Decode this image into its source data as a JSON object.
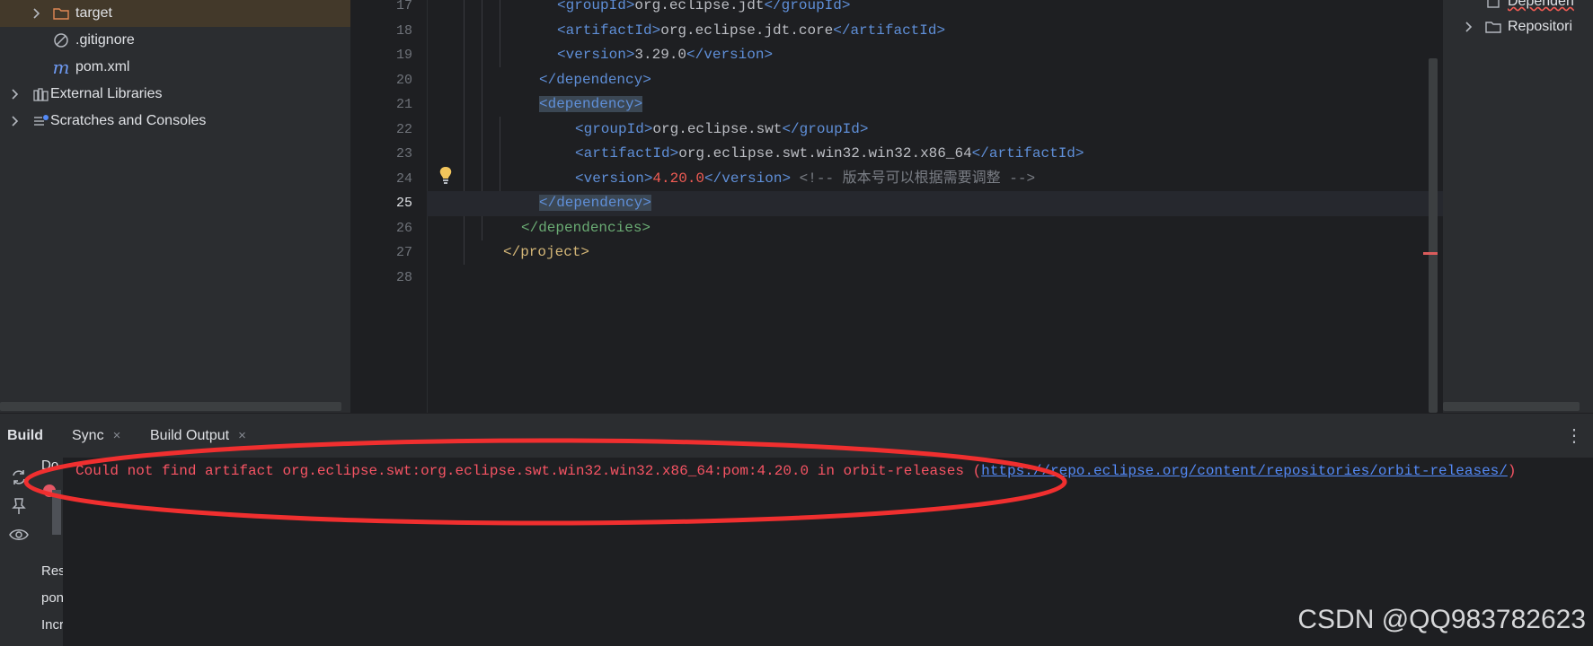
{
  "project_tree": {
    "items": [
      {
        "label": "target",
        "icon": "folder-icon",
        "expandable": true,
        "selected": true
      },
      {
        "label": ".gitignore",
        "icon": "ignored-file-icon",
        "expandable": false
      },
      {
        "label": "pom.xml",
        "icon": "maven-file-icon",
        "expandable": false
      },
      {
        "label": "External Libraries",
        "icon": "library-icon",
        "expandable": true
      },
      {
        "label": "Scratches and Consoles",
        "icon": "scratches-icon",
        "expandable": true
      }
    ]
  },
  "editor": {
    "current_line": 25,
    "line_numbers": [
      "17",
      "18",
      "19",
      "20",
      "21",
      "22",
      "23",
      "24",
      "25",
      "26",
      "27",
      "28"
    ],
    "lines": {
      "l17": {
        "open": "<groupId>",
        "text": "org.eclipse.jdt",
        "close": "</groupId>"
      },
      "l18": {
        "open": "<artifactId>",
        "text": "org.eclipse.jdt.core",
        "close": "</artifactId>"
      },
      "l19": {
        "open": "<version>",
        "text": "3.29.0",
        "close": "</version>"
      },
      "l20": {
        "close": "</dependency>"
      },
      "l21": {
        "open": "<dependency>"
      },
      "l22": {
        "open": "<groupId>",
        "text": "org.eclipse.swt",
        "close": "</groupId>"
      },
      "l23": {
        "open": "<artifactId>",
        "text": "org.eclipse.swt.win32.win32.x86_64",
        "close": "</artifactId>"
      },
      "l24": {
        "open": "<version>",
        "text": "4.20.0",
        "close": "</version>",
        "comment": "<!-- 版本号可以根据需要调整 -->"
      },
      "l25": {
        "close": "</dependency>"
      },
      "l26": {
        "close": "</dependencies>"
      },
      "l27": {
        "close": "</project>"
      }
    }
  },
  "maven_pane": {
    "items": [
      {
        "label": "Dependen",
        "icon": "dependencies-icon"
      },
      {
        "label": "Repositori",
        "icon": "repositories-icon"
      }
    ]
  },
  "build_window": {
    "tabs": [
      {
        "label": "Build",
        "active": true,
        "closable": false
      },
      {
        "label": "Sync",
        "closable": true
      },
      {
        "label": "Build Output",
        "closable": true
      }
    ],
    "close_glyph": "×",
    "more_glyph": "⋮",
    "tree_fragments": [
      "Do",
      "Res",
      "pon",
      "Incr"
    ],
    "error": {
      "message": "Could not find artifact org.eclipse.swt:org.eclipse.swt.win32.win32.x86_64:pom:4.20.0 in orbit-releases (",
      "link": "https://repo.eclipse.org/content/repositories/orbit-releases/",
      "suffix": ")"
    }
  },
  "watermark": "CSDN @QQ983782623",
  "colors": {
    "accent_red": "#f02f2f",
    "error_text": "#f75464",
    "link": "#548af7"
  }
}
